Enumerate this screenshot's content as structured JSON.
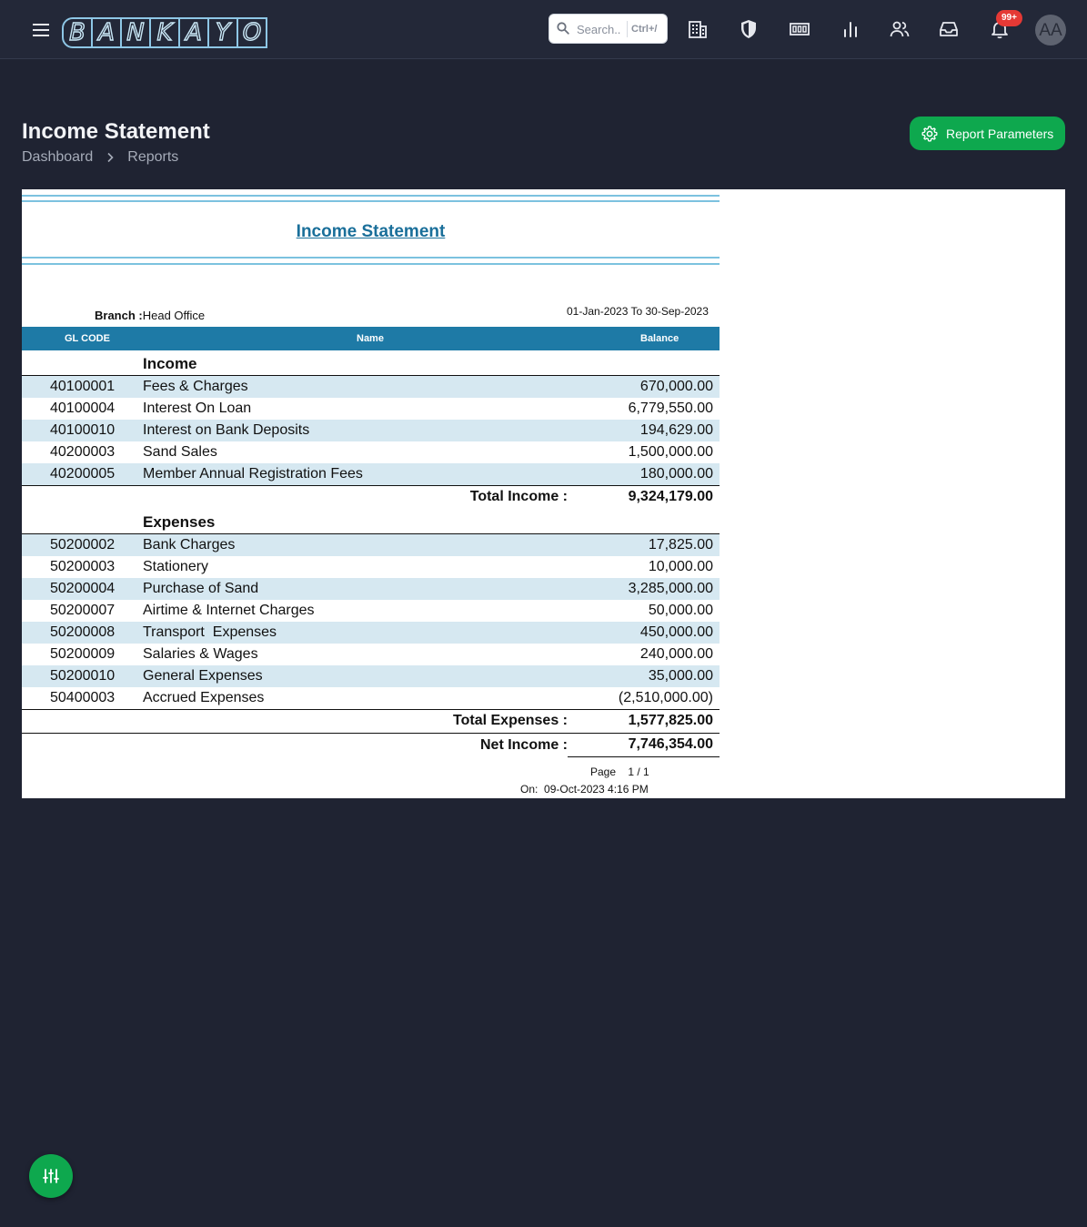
{
  "app": {
    "logo_letters": [
      "B",
      "A",
      "N",
      "K",
      "A",
      "Y",
      "O"
    ]
  },
  "topbar": {
    "search_placeholder": "Search..",
    "search_shortcut": "Ctrl+/",
    "notifications_badge": "99+",
    "avatar_initials": "AA",
    "icons": [
      "menu-icon",
      "search-icon",
      "building-icon",
      "shield-icon",
      "money-icon",
      "bar-chart-icon",
      "users-icon",
      "inbox-icon",
      "bell-icon"
    ]
  },
  "page": {
    "title": "Income Statement",
    "breadcrumb": [
      "Dashboard",
      "Reports"
    ],
    "params_button": "Report Parameters"
  },
  "report": {
    "title": "Income Statement",
    "branch_label": "Branch :",
    "branch_value": "Head Office",
    "period": "01-Jan-2023 To 30-Sep-2023",
    "columns": [
      "GL CODE",
      "Name",
      "Balance"
    ],
    "income": {
      "heading": "Income",
      "rows": [
        {
          "code": "40100001",
          "name": "Fees & Charges",
          "balance": "670,000.00"
        },
        {
          "code": "40100004",
          "name": "Interest On Loan",
          "balance": "6,779,550.00"
        },
        {
          "code": "40100010",
          "name": "Interest on Bank Deposits",
          "balance": "194,629.00"
        },
        {
          "code": "40200003",
          "name": "Sand Sales",
          "balance": "1,500,000.00"
        },
        {
          "code": "40200005",
          "name": "Member Annual Registration Fees",
          "balance": "180,000.00"
        }
      ],
      "total_label": "Total Income :",
      "total": "9,324,179.00"
    },
    "expenses": {
      "heading": "Expenses",
      "rows": [
        {
          "code": "50200002",
          "name": "Bank Charges",
          "balance": "17,825.00"
        },
        {
          "code": "50200003",
          "name": "Stationery",
          "balance": "10,000.00"
        },
        {
          "code": "50200004",
          "name": "Purchase of Sand",
          "balance": "3,285,000.00"
        },
        {
          "code": "50200007",
          "name": "Airtime & Internet Charges",
          "balance": "50,000.00"
        },
        {
          "code": "50200008",
          "name": "Transport  Expenses",
          "balance": "450,000.00"
        },
        {
          "code": "50200009",
          "name": "Salaries & Wages",
          "balance": "240,000.00"
        },
        {
          "code": "50200010",
          "name": "General Expenses",
          "balance": "35,000.00"
        },
        {
          "code": "50400003",
          "name": "Accrued Expenses",
          "balance": "(2,510,000.00)"
        }
      ],
      "total_label": "Total Expenses :",
      "total": "1,577,825.00"
    },
    "net_label": "Net Income :",
    "net": "7,746,354.00",
    "page_label": "Page",
    "page_value": "1 / 1",
    "printed_label": "On:",
    "printed_value": "09-Oct-2023 4:16 PM"
  },
  "colors": {
    "background": "#1f2332",
    "accent_green": "#0ea84e",
    "table_header": "#1e7aa6",
    "row_shade": "#d6e8f1",
    "badge_red": "#e53935"
  }
}
